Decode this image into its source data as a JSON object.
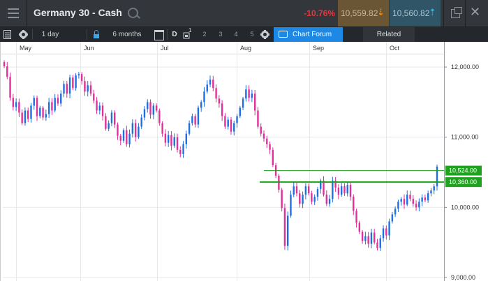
{
  "header": {
    "title": "Germany 30 - Cash",
    "change": "-10.76%",
    "sell_price": "10,559.82",
    "buy_price": "10,560.82",
    "colors": {
      "negative": "#e0393e",
      "sell_bg": "#6a5535",
      "buy_bg": "#2f5566",
      "sell_arrow": "#f08a00",
      "buy_arrow": "#29b6e8"
    }
  },
  "toolbar": {
    "interval": "1 day",
    "range": "6 months",
    "draw_label": "D",
    "draw_superscript": "1",
    "levels": [
      "2",
      "3",
      "4",
      "5"
    ],
    "forum_label": "Chart Forum",
    "related_label": "Related",
    "icons": [
      "grid-icon",
      "gear-icon",
      "lock-icon",
      "calendar-icon",
      "gear-icon",
      "chat-icon"
    ]
  },
  "chart_data": {
    "type": "candlestick",
    "months": [
      "May",
      "Jun",
      "Jul",
      "Aug",
      "Sep",
      "Oct"
    ],
    "y_ticks": [
      "12,000.00",
      "11,000.00",
      "10,000.00",
      "9,000.00"
    ],
    "ylim": [
      8950,
      12180
    ],
    "lines": [
      {
        "label": "10,524.00",
        "value": 10524
      },
      {
        "label": "10,360.00",
        "value": 10360
      }
    ],
    "colors": {
      "up": "#1f6fe0",
      "down": "#e0309a",
      "line": "#1aa31a",
      "tag_bg": "#1fa31f"
    },
    "closes": [
      12010,
      11860,
      11560,
      11430,
      11500,
      11350,
      11200,
      11380,
      11260,
      11450,
      11560,
      11300,
      11420,
      11280,
      11330,
      11500,
      11380,
      11560,
      11480,
      11620,
      11760,
      11620,
      11850,
      11700,
      11880,
      11900,
      11800,
      11650,
      11740,
      11620,
      11520,
      11380,
      11450,
      11300,
      11120,
      11200,
      11350,
      11180,
      11020,
      10950,
      11100,
      10900,
      11050,
      11200,
      11000,
      11150,
      11280,
      11400,
      11500,
      11320,
      11450,
      11380,
      11200,
      11050,
      10920,
      11030,
      10880,
      11000,
      10820,
      10760,
      10900,
      11050,
      11200,
      11300,
      11180,
      11420,
      11500,
      11650,
      11750,
      11820,
      11700,
      11550,
      11480,
      11300,
      11150,
      11250,
      11080,
      11200,
      11300,
      11420,
      11550,
      11680,
      11560,
      11620,
      11380,
      11150,
      11050,
      10980,
      10900,
      10820,
      10600,
      10450,
      10250,
      9990,
      9450,
      9880,
      10180,
      10300,
      10200,
      10050,
      10180,
      10300,
      10200,
      10080,
      10150,
      10260,
      10380,
      10180,
      10050,
      10120,
      10380,
      10280,
      10180,
      10300,
      10200,
      10320,
      10150,
      9950,
      9780,
      9650,
      9520,
      9590,
      9480,
      9640,
      9500,
      9420,
      9560,
      9700,
      9600,
      9800,
      9900,
      9980,
      10080,
      10120,
      10040,
      10180,
      10120,
      10050,
      10000,
      10080,
      10140,
      10100,
      10200,
      10240,
      10300,
      10580
    ]
  }
}
